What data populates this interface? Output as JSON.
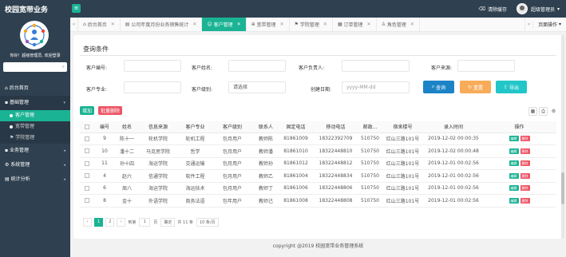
{
  "app": {
    "title": "校园宽带业务"
  },
  "header": {
    "clear_cache": "清除缓存",
    "user": "超级管理员"
  },
  "sidebar": {
    "welcome": "你好！超级管理员, 欢迎登录",
    "items": [
      {
        "label": "后台首页"
      },
      {
        "label": "基础管理",
        "sub": [
          "客户管理",
          "宽带管理",
          "学院管理"
        ]
      },
      {
        "label": "业务管理"
      },
      {
        "label": "系统管理"
      },
      {
        "label": "统计分析"
      }
    ]
  },
  "tabs": [
    {
      "label": "后台首页"
    },
    {
      "label": "公司年度月份业务销售统计"
    },
    {
      "label": "客户管理",
      "active": true
    },
    {
      "label": "宽带管理"
    },
    {
      "label": "学院管理"
    },
    {
      "label": "订单管理"
    },
    {
      "label": "角色管理"
    }
  ],
  "page_ops": "页面操作",
  "query": {
    "title": "查询条件",
    "fields": {
      "id": {
        "label": "客户编号:"
      },
      "name": {
        "label": "客户姓名:"
      },
      "owner": {
        "label": "客户负责人:"
      },
      "source": {
        "label": "客户来源:"
      },
      "major": {
        "label": "客户专业:"
      },
      "level": {
        "label": "客户级别:",
        "value": "请选择"
      },
      "created": {
        "label": "创建日期:",
        "placeholder": "yyyy-MM-dd"
      }
    },
    "buttons": {
      "search": "查询",
      "reset": "重置",
      "export": "导出"
    }
  },
  "toolbar": {
    "add": "增加",
    "batch_delete": "批量删除"
  },
  "table": {
    "columns": [
      "编号",
      "姓名",
      "信息来源",
      "客户专业",
      "客户级别",
      "联系人",
      "固定电话",
      "移动电话",
      "邮政...",
      "宿舍楼号",
      "录入时间",
      "操作"
    ],
    "edit_label": "编辑",
    "delete_label": "删除",
    "rows": [
      {
        "id": "9",
        "name": "陈十一",
        "source": "轮机学院",
        "major": "轮机工程",
        "level": "包月用户",
        "contact": "教师陈",
        "tel": "81861009",
        "mobile": "18322392709",
        "zip": "510750",
        "dorm": "红山三路101号",
        "time": "2019-12-02 00:00:35"
      },
      {
        "id": "10",
        "name": "潘十二",
        "source": "马克思学院",
        "major": "哲学",
        "level": "包月用户",
        "contact": "教师潘",
        "tel": "81861010",
        "mobile": "18322448810",
        "zip": "510750",
        "dorm": "红山三路101号",
        "time": "2019-12-02 00:00:48"
      },
      {
        "id": "11",
        "name": "孙十四",
        "source": "海运学院",
        "major": "交通运输",
        "level": "包月用户",
        "contact": "教师孙",
        "tel": "81861012",
        "mobile": "18322448812",
        "zip": "510750",
        "dorm": "红山三路101号",
        "time": "2019-12-01 00:02:56"
      },
      {
        "id": "4",
        "name": "赵六",
        "source": "信通学院",
        "major": "软件工程",
        "level": "包月用户",
        "contact": "教师乙",
        "tel": "81861004",
        "mobile": "18322448834",
        "zip": "510750",
        "dorm": "红山三路101号",
        "time": "2019-12-01 00:02:56"
      },
      {
        "id": "6",
        "name": "周八",
        "source": "海运学院",
        "major": "海运技术",
        "level": "包月用户",
        "contact": "教师丁",
        "tel": "81861006",
        "mobile": "18322448806",
        "zip": "510750",
        "dorm": "红山三路101号",
        "time": "2019-12-01 00:02:56"
      },
      {
        "id": "8",
        "name": "金十",
        "source": "外语学院",
        "major": "商务法语",
        "level": "包年用户",
        "contact": "教师己",
        "tel": "81861008",
        "mobile": "18322448808",
        "zip": "510750",
        "dorm": "红山三路101号",
        "time": "2019-12-01 00:02:56"
      }
    ]
  },
  "pager": {
    "pages": [
      "1",
      "2"
    ],
    "current": "1",
    "goto_label": "到第",
    "goto_value": "1",
    "page_suffix": "页",
    "confirm": "确定",
    "total": "共 11 条",
    "page_size": "10 条/页"
  },
  "footer": "copyright @2019 校园宽带业务管理系统",
  "colors": {
    "accent": "#1ab394",
    "sidebar": "#2f4050",
    "query": "#1c84c6",
    "reset": "#f8ac59",
    "export": "#23c6c8",
    "danger": "#ed5565"
  }
}
